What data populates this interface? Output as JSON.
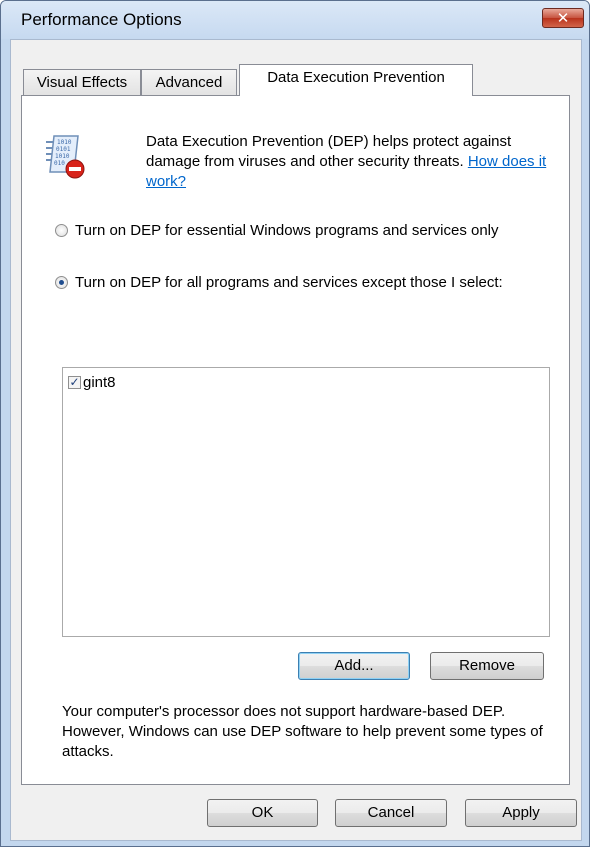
{
  "window": {
    "title": "Performance Options",
    "close_symbol": "✕"
  },
  "tabs": [
    {
      "label": "Visual Effects",
      "active": false
    },
    {
      "label": "Advanced",
      "active": false
    },
    {
      "label": "Data Execution Prevention",
      "active": true
    }
  ],
  "dep": {
    "description": "Data Execution Prevention (DEP) helps protect against damage from viruses and other security threats.",
    "help_link": "How does it work?",
    "icon": "dep-shield-icon",
    "options": [
      {
        "label": "Turn on DEP for essential Windows programs and services only",
        "selected": false
      },
      {
        "label": "Turn on DEP for all programs and services except those I select:",
        "selected": true
      }
    ],
    "exceptions": [
      {
        "name": "gint8",
        "checked": true
      }
    ],
    "add_label": "Add...",
    "remove_label": "Remove",
    "note": "Your computer's processor does not support hardware-based DEP. However, Windows can use DEP software to help prevent some types of attacks."
  },
  "footer": {
    "ok_label": "OK",
    "cancel_label": "Cancel",
    "apply_label": "Apply"
  },
  "colors": {
    "frame": "#c3d7ee",
    "link": "#0066cc",
    "close_button": "#c7533f"
  }
}
